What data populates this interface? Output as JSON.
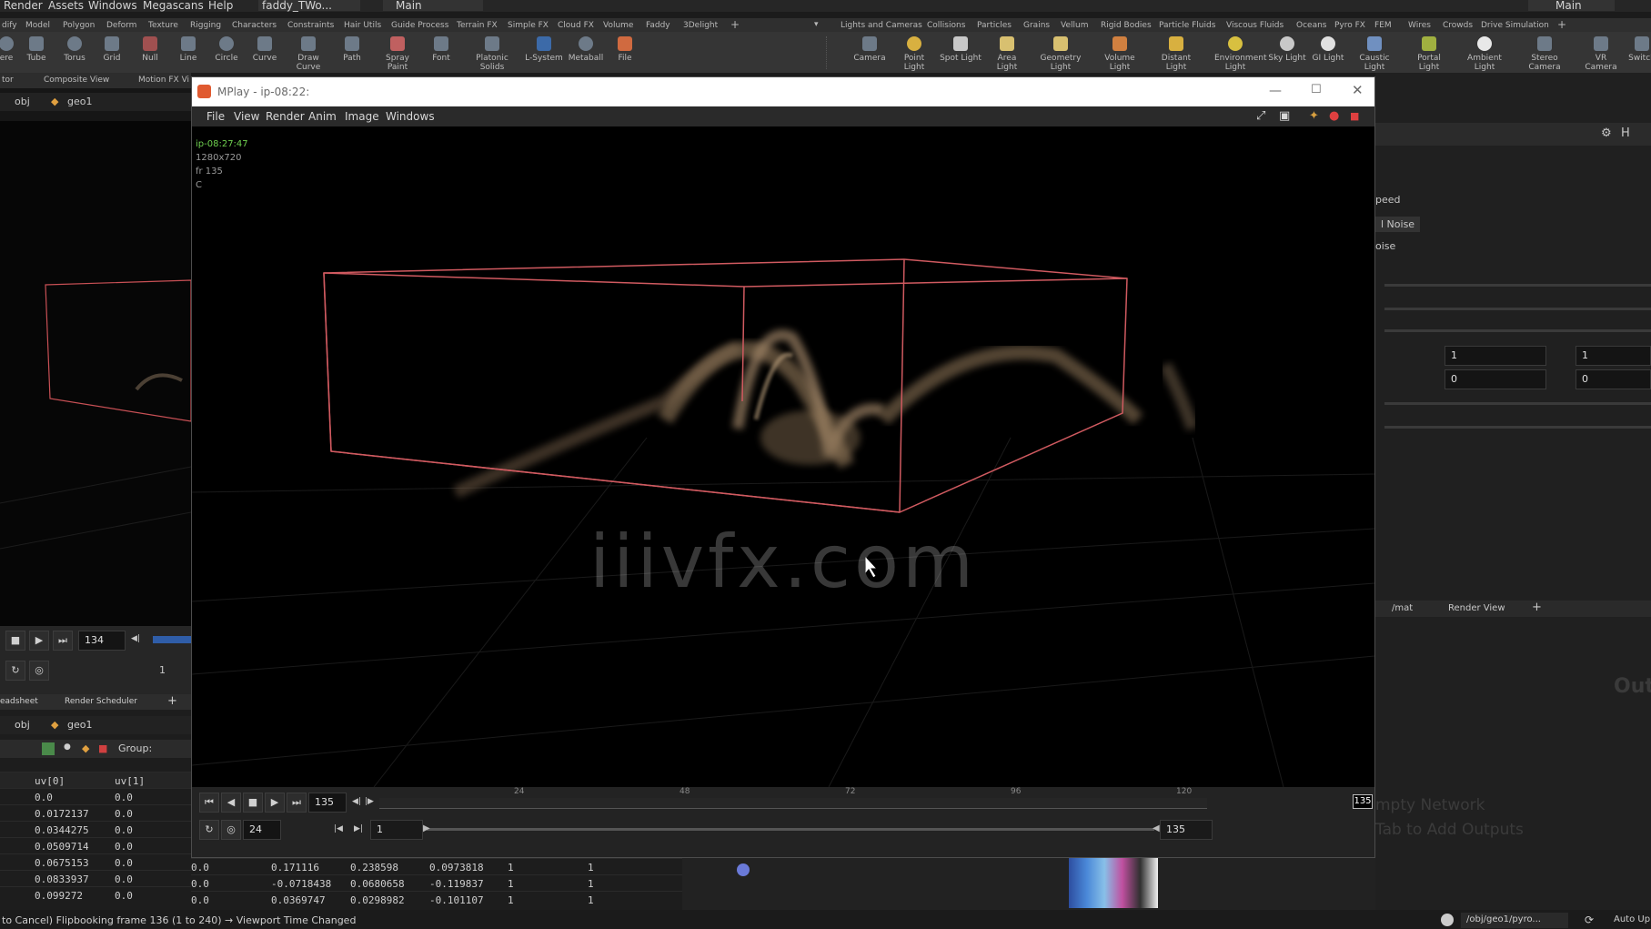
{
  "menubar": {
    "items": [
      "Render",
      "Assets",
      "Windows",
      "Megascans",
      "Help"
    ],
    "file_tab": "faddy_TWo...",
    "desktop": "Main",
    "desktop_right": "Main"
  },
  "shelf_tabs_left": [
    "dify",
    "Model",
    "Polygon",
    "Deform",
    "Texture",
    "Rigging",
    "Characters",
    "Constraints",
    "Hair Utils",
    "Guide Process",
    "Terrain FX",
    "Simple FX",
    "Cloud FX",
    "Volume",
    "Faddy",
    "3Delight"
  ],
  "shelf_tabs_right": [
    "Lights and Cameras",
    "Collisions",
    "Particles",
    "Grains",
    "Vellum",
    "Rigid Bodies",
    "Particle Fluids",
    "Viscous Fluids",
    "Oceans",
    "Pyro FX",
    "FEM",
    "Wires",
    "Crowds",
    "Drive Simulation"
  ],
  "tools_left": [
    "ere",
    "Tube",
    "Torus",
    "Grid",
    "Null",
    "Line",
    "Circle",
    "Curve",
    "Draw Curve",
    "Path",
    "Spray Paint",
    "Font",
    "Platonic Solids",
    "L-System",
    "Metaball",
    "File"
  ],
  "tools_right": [
    "Camera",
    "Point Light",
    "Spot Light",
    "Area Light",
    "Geometry Light",
    "Volume Light",
    "Distant Light",
    "Environment Light",
    "Sky Light",
    "GI Light",
    "Caustic Light",
    "Portal Light",
    "Ambient Light",
    "Stereo Camera",
    "VR Camera",
    "Switch"
  ],
  "left_panel": {
    "tabs": [
      "tor",
      "Composite View",
      "Motion FX Vi"
    ],
    "path": [
      "obj",
      "geo1"
    ],
    "frame": "134",
    "step": "1",
    "lower_tabs": [
      "eadsheet",
      "Render Scheduler"
    ],
    "lower_path": [
      "obj",
      "geo1"
    ],
    "group_label": "Group:",
    "columns": [
      "uv[0]",
      "uv[1]"
    ],
    "rows": [
      [
        "0.0",
        "0.0"
      ],
      [
        "0.0172137",
        "0.0"
      ],
      [
        "0.0344275",
        "0.0"
      ],
      [
        "0.0509714",
        "0.0"
      ],
      [
        "0.0675153",
        "0.0"
      ],
      [
        "0.0833937",
        "0.0"
      ],
      [
        "0.099272",
        "0.0"
      ]
    ]
  },
  "lower_sheet_rows": [
    [
      "0.0",
      "0.171116",
      "0.238598",
      "0.0973818",
      "1",
      "1"
    ],
    [
      "0.0",
      "-0.0718438",
      "0.0680658",
      "-0.119837",
      "1",
      "1"
    ],
    [
      "0.0",
      "0.0369747",
      "0.0298982",
      "-0.101107",
      "1",
      "1"
    ]
  ],
  "mplay": {
    "title": "MPlay - ip-08:22:",
    "menu": [
      "File",
      "View",
      "Render",
      "Anim",
      "Image",
      "Windows"
    ],
    "info": {
      "name": "ip-08:27:47",
      "res": "1280x720",
      "frame": "fr 135",
      "channel": "C"
    },
    "watermark": "iiivfx.com",
    "controls": {
      "current_frame": "135",
      "fps": "24",
      "range_start": "1",
      "range_end": "135",
      "end_marker": "135"
    },
    "timeline_ticks": [
      "24",
      "48",
      "72",
      "96",
      "120"
    ]
  },
  "right_panel": {
    "labels": [
      "peed",
      "l Noise",
      "oise"
    ],
    "values": [
      "1",
      "1",
      "0",
      "0"
    ],
    "tabs": [
      "/mat",
      "Render View"
    ],
    "hint_big": "Out",
    "hint1": "mpty Network",
    "hint2": "Tab to Add Outputs"
  },
  "status": {
    "text": "to Cancel) Flipbooking frame 136 (1 to 240) → Viewport Time Changed",
    "path": "/obj/geo1/pyro...",
    "mode": "Auto Up"
  },
  "colors": {
    "accent_green": "#6fd04f",
    "box_red": "#d05a60",
    "smoke": "#a08568"
  }
}
